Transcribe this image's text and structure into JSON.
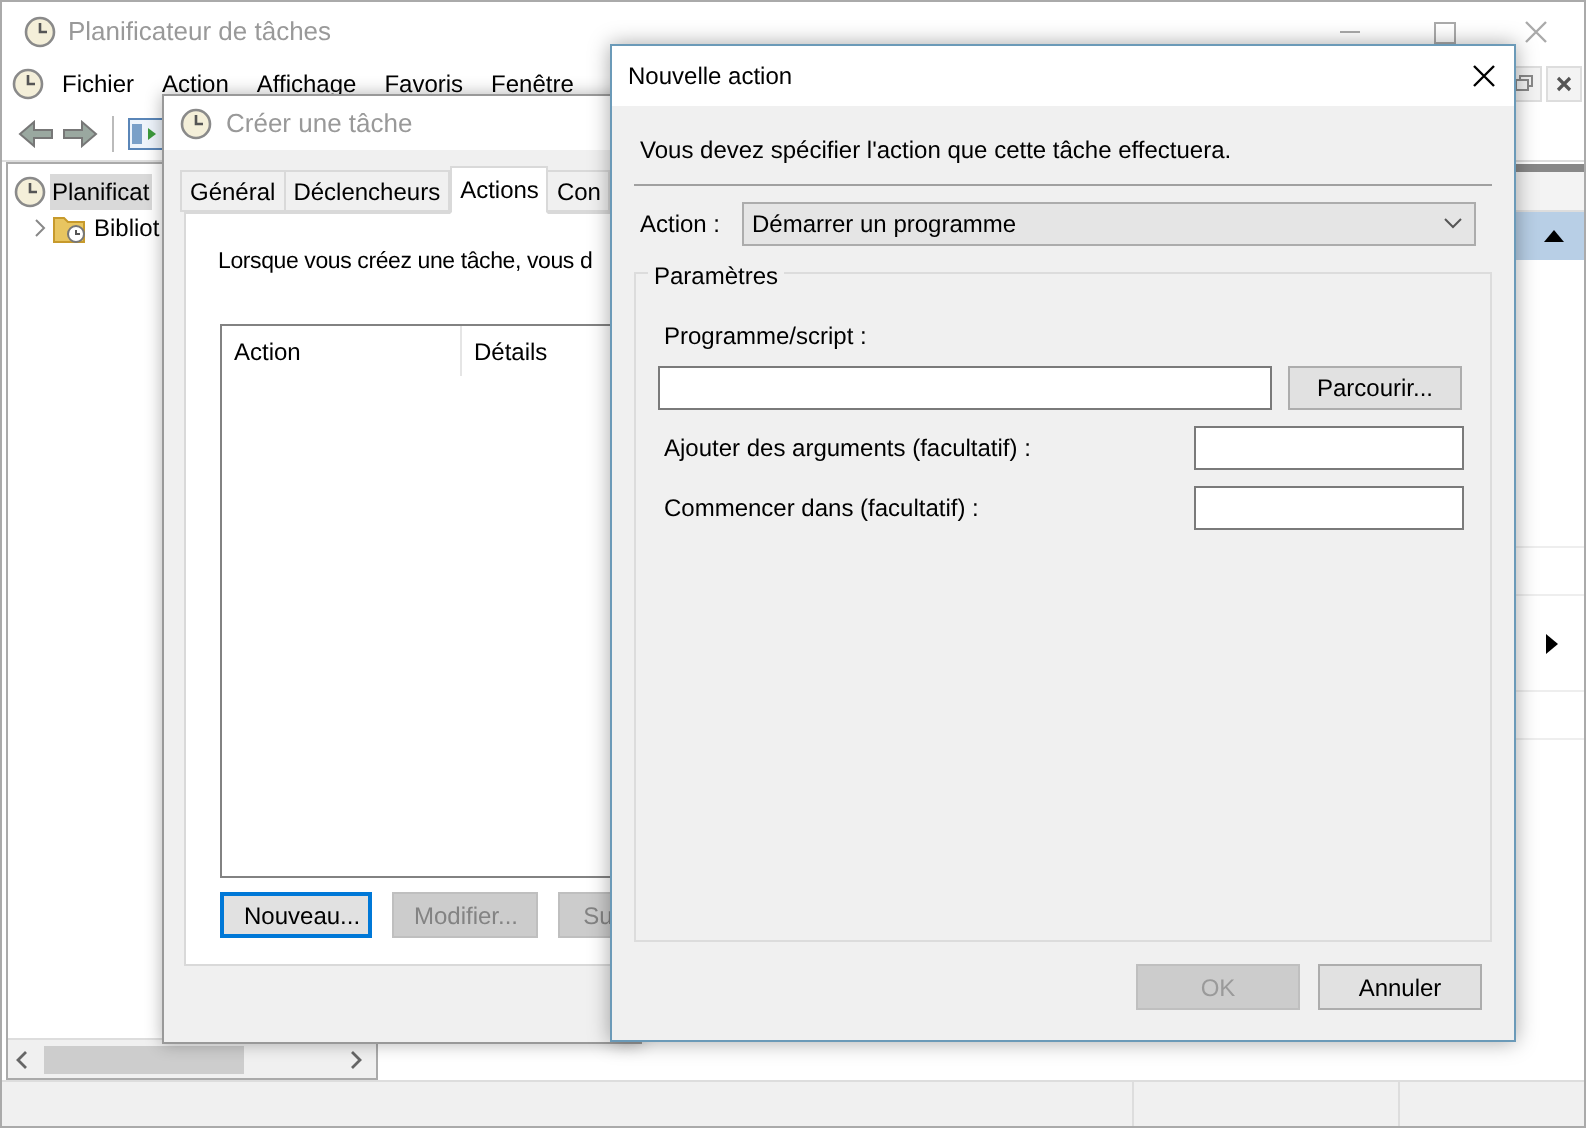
{
  "main_window": {
    "title": "Planificateur de tâches",
    "menu": [
      "Fichier",
      "Action",
      "Affichage",
      "Favoris",
      "Fenêtre"
    ],
    "tree": [
      {
        "label": "Planificat",
        "selected": true,
        "children": [
          {
            "label": "Bibliot",
            "expanded": false,
            "selected": false
          }
        ]
      }
    ]
  },
  "create_task_dialog": {
    "title": "Créer une tâche",
    "tabs": [
      {
        "label": "Général",
        "selected": false
      },
      {
        "label": "Déclencheurs",
        "selected": false
      },
      {
        "label": "Actions",
        "selected": true
      },
      {
        "label": "Con",
        "selected": false
      }
    ],
    "description": "Lorsque vous créez une tâche, vous d",
    "columns": [
      "Action",
      "Détails"
    ],
    "buttons": [
      {
        "label": "Nouveau...",
        "disabled": false,
        "focused": true
      },
      {
        "label": "Modifier...",
        "disabled": true,
        "focused": false
      },
      {
        "label": "Su",
        "disabled": true,
        "focused": false
      }
    ]
  },
  "new_action_dialog": {
    "title": "Nouvelle action",
    "instruction": "Vous devez spécifier l'action que cette tâche effectuera.",
    "action_label": "Action :",
    "action_value": "Démarrer un programme",
    "group_title": "Paramètres",
    "program_label": "Programme/script :",
    "browse_button": "Parcourir...",
    "fields": [
      {
        "label": "Ajouter des arguments (facultatif) :"
      },
      {
        "label": "Commencer dans (facultatif) :"
      }
    ],
    "buttons": [
      {
        "label": "OK",
        "disabled": true
      },
      {
        "label": "Annuler",
        "disabled": false
      }
    ]
  }
}
